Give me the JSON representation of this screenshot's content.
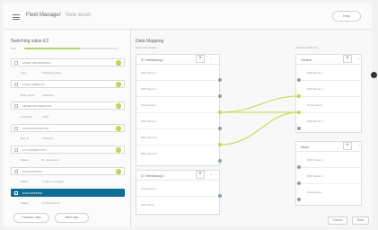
{
  "header": {
    "title": "Fleet Manager",
    "separator": "/",
    "crumb": "New asset",
    "help_label": "Help"
  },
  "sidebar": {
    "title": "Switching value E2",
    "progress_label": "60%",
    "progress_value": 0.6,
    "steps": [
      {
        "label": "ASSET INFORMATION"
      },
      {
        "label": "ASSET ASPECTS"
      },
      {
        "label": "METER INFORMATION"
      },
      {
        "label": "DATA INFORMATION"
      },
      {
        "label": "IoT CONNECTIVITY"
      },
      {
        "label": "DATA MAPPING"
      },
      {
        "label": "DATA MAPPING"
      }
    ],
    "details": [
      {
        "key": "Type",
        "value": "Switching value"
      },
      {
        "key": "Data points",
        "value": "Unknown"
      },
      {
        "key": "Container",
        "value": "PGW"
      },
      {
        "key": "Bus ID",
        "value": "Unknown"
      },
      {
        "key": "Status",
        "value": "Connected"
      },
      {
        "key": "Status",
        "value": "3 values received"
      },
      {
        "key": "Status",
        "value": "2 Connections"
      }
    ],
    "previous_label": "Previous step",
    "next_label": "Next step"
  },
  "main": {
    "title": "Data Mapping",
    "source_label": "DATA SOURCES",
    "target_label": "ASSET ASPECTS",
    "sources": [
      {
        "title": "S7 Verbindung 1",
        "rows": [
          "DRP Name 1",
          "DRP Name 2",
          "Temperature",
          "DRP Name 4",
          "DRP Name 5",
          "DRP Name 6"
        ]
      },
      {
        "title": "S7 Verbindung 2",
        "rows": [
          "Temperature",
          "DRP Name"
        ]
      }
    ],
    "targets": [
      {
        "title": "Generic",
        "rows": [
          "DRP Name 1",
          "DRP Name 2",
          "Temperature",
          "DRP Name 3"
        ]
      },
      {
        "title": "Motor",
        "rows": [
          "DRP Name 1",
          "DRP Name 2",
          "Temperature"
        ]
      }
    ],
    "cancel_label": "Cancel",
    "save_label": "Save"
  },
  "colors": {
    "accent": "#0f6d94",
    "success": "#b7d344",
    "link": "#c8d64a"
  }
}
